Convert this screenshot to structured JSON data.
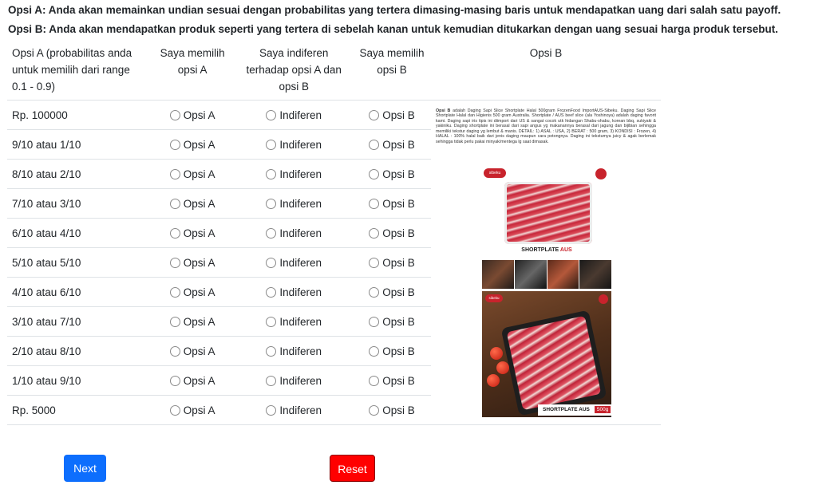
{
  "instructions": {
    "option_a": "Opsi A: Anda akan memainkan undian sesuai dengan probabilitas yang tertera dimasing-masing baris untuk mendapatkan uang dari salah satu payoff.",
    "option_b": "Opsi B: Anda akan mendapatkan produk seperti yang tertera di sebelah kanan untuk kemudian ditukarkan dengan uang sesuai harga produk tersebut."
  },
  "table": {
    "headers": {
      "label": "Opsi A (probabilitas anda untuk memilih dari range 0.1 - 0.9)",
      "choose_a": "Saya memilih opsi A",
      "indifferent": "Saya indiferen terhadap opsi A dan opsi B",
      "choose_b": "Saya memilih opsi B",
      "option_b": "Opsi B"
    },
    "option_labels": {
      "a": "Opsi A",
      "indifferent": "Indiferen",
      "b": "Opsi B"
    },
    "rows": [
      "Rp. 100000",
      "9/10 atau 1/10",
      "8/10 atau 2/10",
      "7/10 atau 3/10",
      "6/10 atau 4/10",
      "5/10 atau 5/10",
      "4/10 atau 6/10",
      "3/10 atau 7/10",
      "2/10 atau 8/10",
      "1/10 atau 9/10",
      "Rp. 5000"
    ]
  },
  "product": {
    "description_bold": "Opsi B",
    "description": "adalah Daging Sapi Slice Shortplate Halal 500gram FrozenFood ImportAUS-Sibeku. Daging Sapi Slice Shortplate Halal dan Higienis 500 gram Australia. Shortplate / AUS beef slice (ala Yoshinoya) adalah daging favorit kami. Daging sapi iris tipis ini diimport dari US & sangat cocok utk hidangan Shabu-shabu, korean bbq, sukiyaki & yakiniku. Daging shortplate ini berasal dari sapi angus yg makanannya berasal dari jagung dan bijibian sehingga memiliki tekstur daging yg lembut & manis. DETAIL: 1) ASAL : USA, 2) BERAT : 500 gram, 3) KONDISI : Frozen, 4) HALAL : 100% halal baik dari jenis daging maupun cara potongnya. Daging ini tekstumya juicy & agak berlemak sehingga tidak perlu pakai minyak/mentega lg saat dimasak.",
    "title_black": "SHORTPLATE",
    "title_red": "AUS",
    "logo_text": "sibeku",
    "strip_label": "SHORTPLATE AUS",
    "strip_weight": "500g"
  },
  "buttons": {
    "next": "Next",
    "reset": "Reset"
  },
  "colors": {
    "next_bg": "#0d6efd",
    "reset_bg": "#ff0000",
    "accent_red": "#c8232c"
  }
}
